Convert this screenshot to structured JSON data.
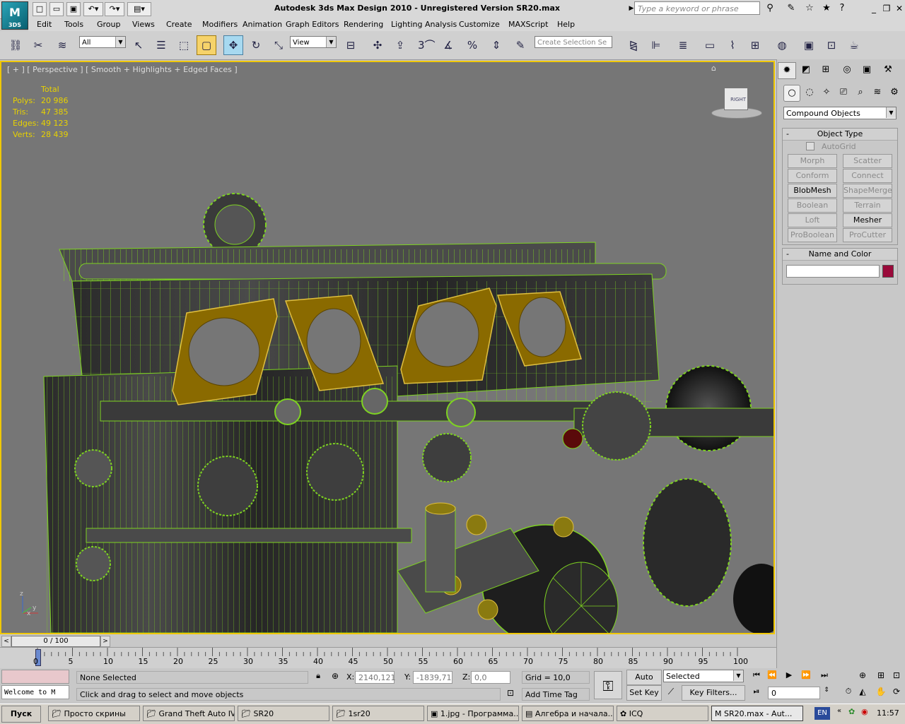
{
  "app": {
    "logo_text": "3DS",
    "title": "Autodesk 3ds Max Design 2010  - Unregistered Version     SR20.max",
    "search_placeholder": "Type a keyword or phrase"
  },
  "menu": [
    "Edit",
    "Tools",
    "Group",
    "Views",
    "Create",
    "Modifiers",
    "Animation",
    "Graph Editors",
    "Rendering",
    "Lighting Analysis",
    "Customize",
    "MAXScript",
    "Help"
  ],
  "toolbar": {
    "selection_filter": "All",
    "ref_coord": "View",
    "snap_label": "3",
    "selection_set_placeholder": "Create Selection Se"
  },
  "viewport": {
    "label": "[ + ] [ Perspective ] [ Smooth + Highlights + Edged Faces ]",
    "stats": {
      "header": "Total",
      "rows": [
        {
          "label": "Polys:",
          "value": "20 986"
        },
        {
          "label": "Tris:",
          "value": "47 385"
        },
        {
          "label": "Edges:",
          "value": "49 123"
        },
        {
          "label": "Verts:",
          "value": "28 439"
        }
      ]
    },
    "viewcube_label": "RIGHT",
    "axis_z": "z",
    "axis_y": "y",
    "axis_x": "x",
    "wire_color": "#7ed321",
    "flange_color": "#8a6a00"
  },
  "command_panel": {
    "category_dropdown": "Compound Objects",
    "object_type_title": "Object Type",
    "autogrid_label": "AutoGrid",
    "buttons": [
      {
        "label": "Morph",
        "enabled": false
      },
      {
        "label": "Scatter",
        "enabled": false
      },
      {
        "label": "Conform",
        "enabled": false
      },
      {
        "label": "Connect",
        "enabled": false
      },
      {
        "label": "BlobMesh",
        "enabled": true
      },
      {
        "label": "ShapeMerge",
        "enabled": false
      },
      {
        "label": "Boolean",
        "enabled": false
      },
      {
        "label": "Terrain",
        "enabled": false
      },
      {
        "label": "Loft",
        "enabled": false
      },
      {
        "label": "Mesher",
        "enabled": true
      },
      {
        "label": "ProBoolean",
        "enabled": false
      },
      {
        "label": "ProCutter",
        "enabled": false
      }
    ],
    "name_color_title": "Name and Color",
    "object_color": "#9a0a3a"
  },
  "timeline": {
    "frame_counter": "0 / 100",
    "ticks": [
      "0",
      "5",
      "10",
      "15",
      "20",
      "25",
      "30",
      "35",
      "40",
      "45",
      "50",
      "55",
      "60",
      "65",
      "70",
      "75",
      "80",
      "85",
      "90",
      "95",
      "100"
    ]
  },
  "status": {
    "maxscript_listener": "Welcome to M",
    "selection": "None Selected",
    "prompt": "Click and drag to select and move objects",
    "x_label": "X:",
    "x_value": "2140,121",
    "y_label": "Y:",
    "y_value": "-1839,71",
    "z_label": "Z:",
    "z_value": "0,0",
    "grid": "Grid = 10,0",
    "add_time_tag": "Add Time Tag",
    "auto_key": "Auto Key",
    "set_key": "Set Key",
    "key_mode": "Selected",
    "key_filters": "Key Filters...",
    "frame_value": "0"
  },
  "taskbar": {
    "start": "Пуск",
    "tasks": [
      {
        "label": "Просто скрины",
        "active": false
      },
      {
        "label": "Grand Theft Auto IV",
        "active": false
      },
      {
        "label": "SR20",
        "active": false
      },
      {
        "label": "1sr20",
        "active": false
      },
      {
        "label": "1.jpg - Программа...",
        "active": false
      },
      {
        "label": "Алгебра и начала...",
        "active": false
      },
      {
        "label": "ICQ",
        "active": false
      },
      {
        "label": "SR20.max - Aut...",
        "active": true
      }
    ],
    "lang": "EN",
    "clock": "11:57"
  }
}
